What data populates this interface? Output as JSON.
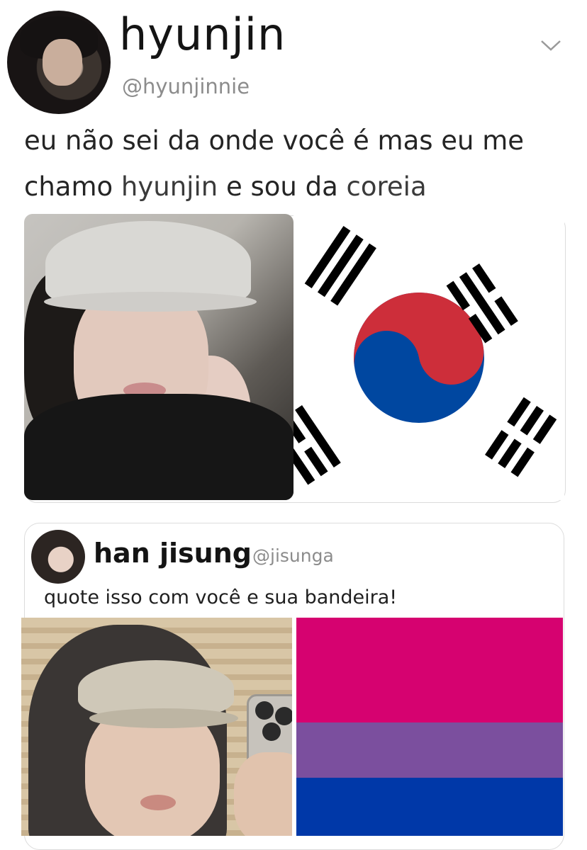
{
  "tweet": {
    "display_name": "hyunjin",
    "handle": "@hyunjinnie",
    "text_line1": "eu não sei da onde você é mas eu me",
    "text_line2_prefix": "chamo ",
    "text_line2_name": "hyunjin",
    "text_line2_mid": " e sou da ",
    "text_line2_country": "coreia",
    "menu_icon": "chevron-down-icon"
  },
  "quote": {
    "display_name": "han jisung",
    "handle": "@jisunga",
    "text": "quote isso com você e sua bandeira!"
  },
  "flags": {
    "korea": {
      "red": "#cd2e3a",
      "blue": "#0047a0",
      "black": "#000000"
    },
    "bisexual": {
      "pink": "#d60270",
      "purple": "#9b4f96",
      "blue": "#0038a8",
      "proportions": [
        0.4,
        0.2,
        0.4
      ]
    }
  }
}
